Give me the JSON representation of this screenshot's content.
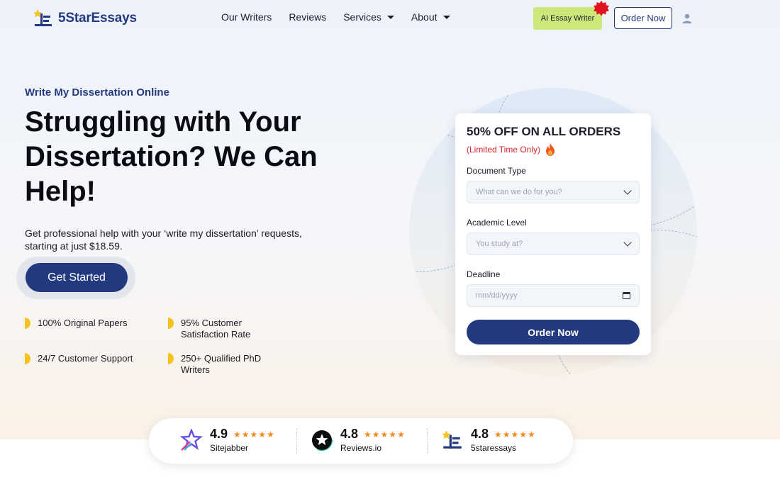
{
  "brand": {
    "name": "5StarEssays"
  },
  "nav": {
    "links": [
      "Our Writers",
      "Reviews",
      "Services",
      "About"
    ],
    "ai_button": "AI Essay Writer",
    "order_button": "Order Now"
  },
  "hero": {
    "eyebrow": "Write My Dissertation Online",
    "headline": "Struggling with Your Dissertation? We Can Help!",
    "subtext": "Get professional help with your ‘write my dissertation’ requests, starting at just $18.59.",
    "cta": "Get Started",
    "features": [
      "100% Original Papers",
      "95% Customer Satisfaction Rate",
      "24/7 Customer Support",
      "250+ Qualified PhD Writers"
    ]
  },
  "form": {
    "title": "50% OFF ON ALL ORDERS",
    "subtitle": "(Limited Time Only)",
    "document_type_label": "Document Type",
    "document_type_placeholder": "What can we do for you?",
    "academic_level_label": "Academic Level",
    "academic_level_placeholder": "You study at?",
    "deadline_label": "Deadline",
    "deadline_placeholder": "mm/dd/yyyy",
    "submit": "Order Now"
  },
  "ratings": [
    {
      "score": "4.9",
      "name": "Sitejabber",
      "stars": "★★★★★",
      "icon": "sitejabber-logo-icon"
    },
    {
      "score": "4.8",
      "name": "Reviews.io",
      "stars": "★★★★★",
      "icon": "reviewsio-logo-icon"
    },
    {
      "score": "4.8",
      "name": "5staressays",
      "stars": "★★★★★",
      "icon": "5staressays-logo-icon"
    }
  ],
  "colors": {
    "brand_blue": "#243a80",
    "accent_yellow": "#f6c21c",
    "ai_green": "#cde87a",
    "promo_red": "#d8262b",
    "star_orange": "#f38a1a"
  }
}
